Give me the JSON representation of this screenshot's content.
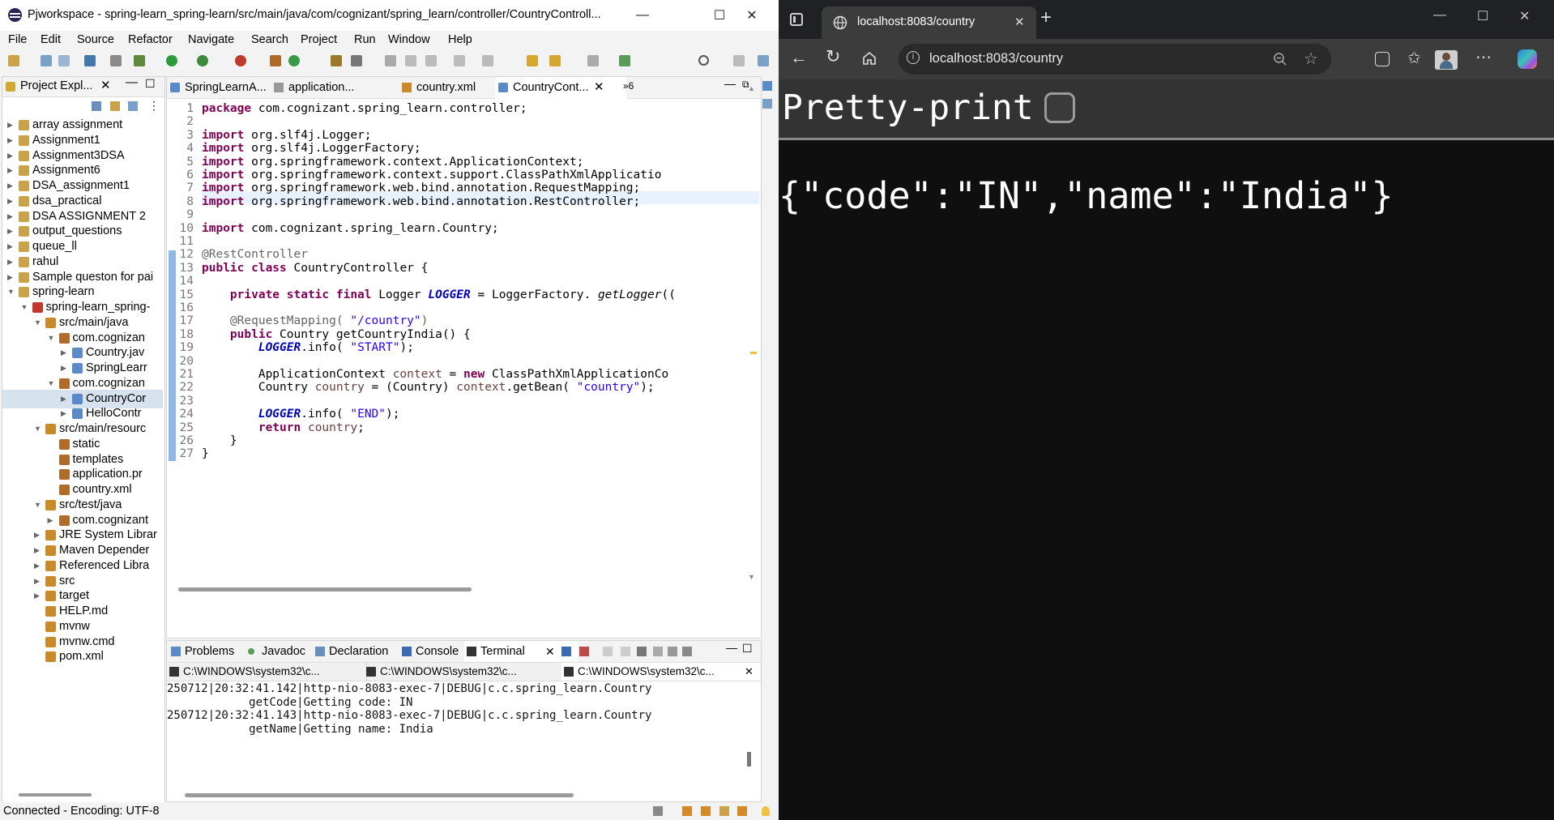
{
  "eclipse": {
    "title": "Pjworkspace - spring-learn_spring-learn/src/main/java/com/cognizant/spring_learn/controller/CountryControll...",
    "window_controls": [
      "—",
      "☐",
      "✕"
    ],
    "menu": [
      "File",
      "Edit",
      "Source",
      "Refactor",
      "Navigate",
      "Search",
      "Project",
      "Run",
      "Window",
      "Help"
    ],
    "project_explorer": {
      "title": "Project Expl...",
      "items": [
        {
          "label": "array assignment",
          "depth": 0,
          "expanded": false
        },
        {
          "label": "Assignment1",
          "depth": 0,
          "expanded": false
        },
        {
          "label": "Assignment3DSA",
          "depth": 0,
          "expanded": false
        },
        {
          "label": "Assignment6",
          "depth": 0,
          "expanded": false
        },
        {
          "label": "DSA_assignment1",
          "depth": 0,
          "expanded": false
        },
        {
          "label": "dsa_practical",
          "depth": 0,
          "expanded": false
        },
        {
          "label": "DSA ASSIGNMENT 2",
          "depth": 0,
          "expanded": false
        },
        {
          "label": "output_questions",
          "depth": 0,
          "expanded": false
        },
        {
          "label": "queue_ll",
          "depth": 0,
          "expanded": false
        },
        {
          "label": "rahul",
          "depth": 0,
          "expanded": false
        },
        {
          "label": "Sample queston for pai",
          "depth": 0,
          "expanded": false
        },
        {
          "label": "spring-learn",
          "depth": 0,
          "expanded": true
        },
        {
          "label": "spring-learn_spring-",
          "depth": 1,
          "expanded": true
        },
        {
          "label": "src/main/java",
          "depth": 2,
          "expanded": true
        },
        {
          "label": "com.cognizan",
          "depth": 3,
          "expanded": true
        },
        {
          "label": "Country.jav",
          "depth": 4,
          "expanded": false
        },
        {
          "label": "SpringLearr",
          "depth": 4,
          "expanded": false
        },
        {
          "label": "com.cognizan",
          "depth": 3,
          "expanded": true
        },
        {
          "label": "CountryCor",
          "depth": 4,
          "expanded": false,
          "selected": true
        },
        {
          "label": "HelloContr",
          "depth": 4,
          "expanded": false
        },
        {
          "label": "src/main/resourc",
          "depth": 2,
          "expanded": true
        },
        {
          "label": "static",
          "depth": 3,
          "leaf": true
        },
        {
          "label": "templates",
          "depth": 3,
          "leaf": true
        },
        {
          "label": "application.pr",
          "depth": 3,
          "leaf": true
        },
        {
          "label": "country.xml",
          "depth": 3,
          "leaf": true
        },
        {
          "label": "src/test/java",
          "depth": 2,
          "expanded": true
        },
        {
          "label": "com.cognizant",
          "depth": 3,
          "expanded": false
        },
        {
          "label": "JRE System Librar",
          "depth": 2,
          "expanded": false
        },
        {
          "label": "Maven Depender",
          "depth": 2,
          "expanded": false
        },
        {
          "label": "Referenced Libra",
          "depth": 2,
          "expanded": false
        },
        {
          "label": "src",
          "depth": 2,
          "expanded": false
        },
        {
          "label": "target",
          "depth": 2,
          "expanded": false
        },
        {
          "label": "HELP.md",
          "depth": 2,
          "leaf": true
        },
        {
          "label": "mvnw",
          "depth": 2,
          "leaf": true
        },
        {
          "label": "mvnw.cmd",
          "depth": 2,
          "leaf": true
        },
        {
          "label": "pom.xml",
          "depth": 2,
          "leaf": true
        }
      ]
    },
    "editor_tabs": [
      {
        "label": "SpringLearnA..."
      },
      {
        "label": "application..."
      },
      {
        "label": "country.xml"
      },
      {
        "label": "CountryCont...",
        "active": true,
        "close": "✕"
      }
    ],
    "editor_overflow": "»6",
    "code_lines": [
      [
        [
          "kw",
          "package"
        ],
        [
          "",
          "com.cognizant.spring_learn.controller;"
        ]
      ],
      [],
      [
        [
          "kw",
          "import"
        ],
        [
          "",
          "org.slf4j.Logger;"
        ]
      ],
      [
        [
          "kw",
          "import"
        ],
        [
          "",
          "org.slf4j.LoggerFactory;"
        ]
      ],
      [
        [
          "kw",
          "import"
        ],
        [
          "",
          "org.springframework.context.ApplicationContext;"
        ]
      ],
      [
        [
          "kw",
          "import"
        ],
        [
          "",
          "org.springframework.context.support.ClassPathXmlApplicatio"
        ]
      ],
      [
        [
          "kw",
          "import"
        ],
        [
          "",
          "org.springframework.web.bind.annotation.RequestMapping;"
        ]
      ],
      [
        [
          "kw",
          "import"
        ],
        [
          "",
          "org.springframework.web.bind.annotation.RestController;"
        ]
      ],
      [],
      [
        [
          "kw",
          "import"
        ],
        [
          "",
          "com.cognizant.spring_learn.Country;"
        ]
      ],
      [],
      [
        [
          "ann",
          "@RestController"
        ]
      ],
      [
        [
          "kw",
          "public class"
        ],
        [
          "",
          "CountryController {"
        ]
      ],
      [],
      [
        [
          "",
          "    "
        ],
        [
          "kw",
          "private static final"
        ],
        [
          "",
          "Logger"
        ],
        [
          "fld",
          "LOGGER"
        ],
        [
          "",
          "= LoggerFactory."
        ],
        [
          "it",
          "getLogger"
        ],
        [
          "",
          "(("
        ]
      ],
      [],
      [
        [
          "",
          "    "
        ],
        [
          "ann",
          "@RequestMapping("
        ],
        [
          "str",
          "\"/country\""
        ],
        [
          "ann",
          ")"
        ]
      ],
      [
        [
          "",
          "    "
        ],
        [
          "kw",
          "public"
        ],
        [
          "",
          "Country getCountryIndia() {"
        ]
      ],
      [
        [
          "",
          "        "
        ],
        [
          "fld",
          "LOGGER"
        ],
        [
          "",
          ".info("
        ],
        [
          "str",
          "\"START\""
        ],
        [
          "",
          ");"
        ]
      ],
      [],
      [
        [
          "",
          "        ApplicationContext "
        ],
        [
          "var",
          "context"
        ],
        [
          "",
          "= "
        ],
        [
          "kw",
          "new"
        ],
        [
          "",
          "ClassPathXmlApplicationCo"
        ]
      ],
      [
        [
          "",
          "        Country "
        ],
        [
          "var",
          "country"
        ],
        [
          "",
          "= (Country) "
        ],
        [
          "var",
          "context"
        ],
        [
          "",
          ".getBean("
        ],
        [
          "str",
          "\"country\""
        ],
        [
          "",
          ");"
        ]
      ],
      [],
      [
        [
          "",
          "        "
        ],
        [
          "fld",
          "LOGGER"
        ],
        [
          "",
          ".info("
        ],
        [
          "str",
          "\"END\""
        ],
        [
          "",
          ");"
        ]
      ],
      [
        [
          "",
          "        "
        ],
        [
          "kw",
          "return"
        ],
        [
          "var",
          "country"
        ],
        [
          "",
          ";"
        ]
      ],
      [
        [
          "",
          "    }"
        ]
      ],
      [
        [
          "",
          "}"
        ]
      ]
    ],
    "bottom_tabs": [
      {
        "label": "Problems"
      },
      {
        "label": "Javadoc"
      },
      {
        "label": "Declaration"
      },
      {
        "label": "Console"
      },
      {
        "label": "Terminal",
        "active": true,
        "close": "✕"
      }
    ],
    "terminal_tabs": [
      {
        "label": "C:\\WINDOWS\\system32\\c..."
      },
      {
        "label": "C:\\WINDOWS\\system32\\c..."
      },
      {
        "label": "C:\\WINDOWS\\system32\\c...",
        "active": true,
        "close": "✕"
      }
    ],
    "terminal_lines": [
      "250712|20:32:41.142|http-nio-8083-exec-7|DEBUG|c.c.spring_learn.Country",
      "            getCode|Getting code: IN",
      "250712|20:32:41.143|http-nio-8083-exec-7|DEBUG|c.c.spring_learn.Country",
      "            getName|Getting name: India"
    ],
    "status": "Connected - Encoding: UTF-8"
  },
  "browser": {
    "tab_title": "localhost:8083/country",
    "tab_close": "✕",
    "new_tab": "+",
    "url": "localhost:8083/country",
    "window_controls": [
      "—",
      "☐",
      "✕"
    ],
    "pretty_print_label": "Pretty-print",
    "json_body": "{\"code\":\"IN\",\"name\":\"India\"}"
  },
  "colors": {
    "keyword": "#7f0055",
    "string": "#2a00ff",
    "annotation": "#646464",
    "field": "#0000c0",
    "local_var": "#6a3e3e",
    "browser_bg": "#0f0f0f",
    "browser_chrome": "#3c3c3c"
  }
}
